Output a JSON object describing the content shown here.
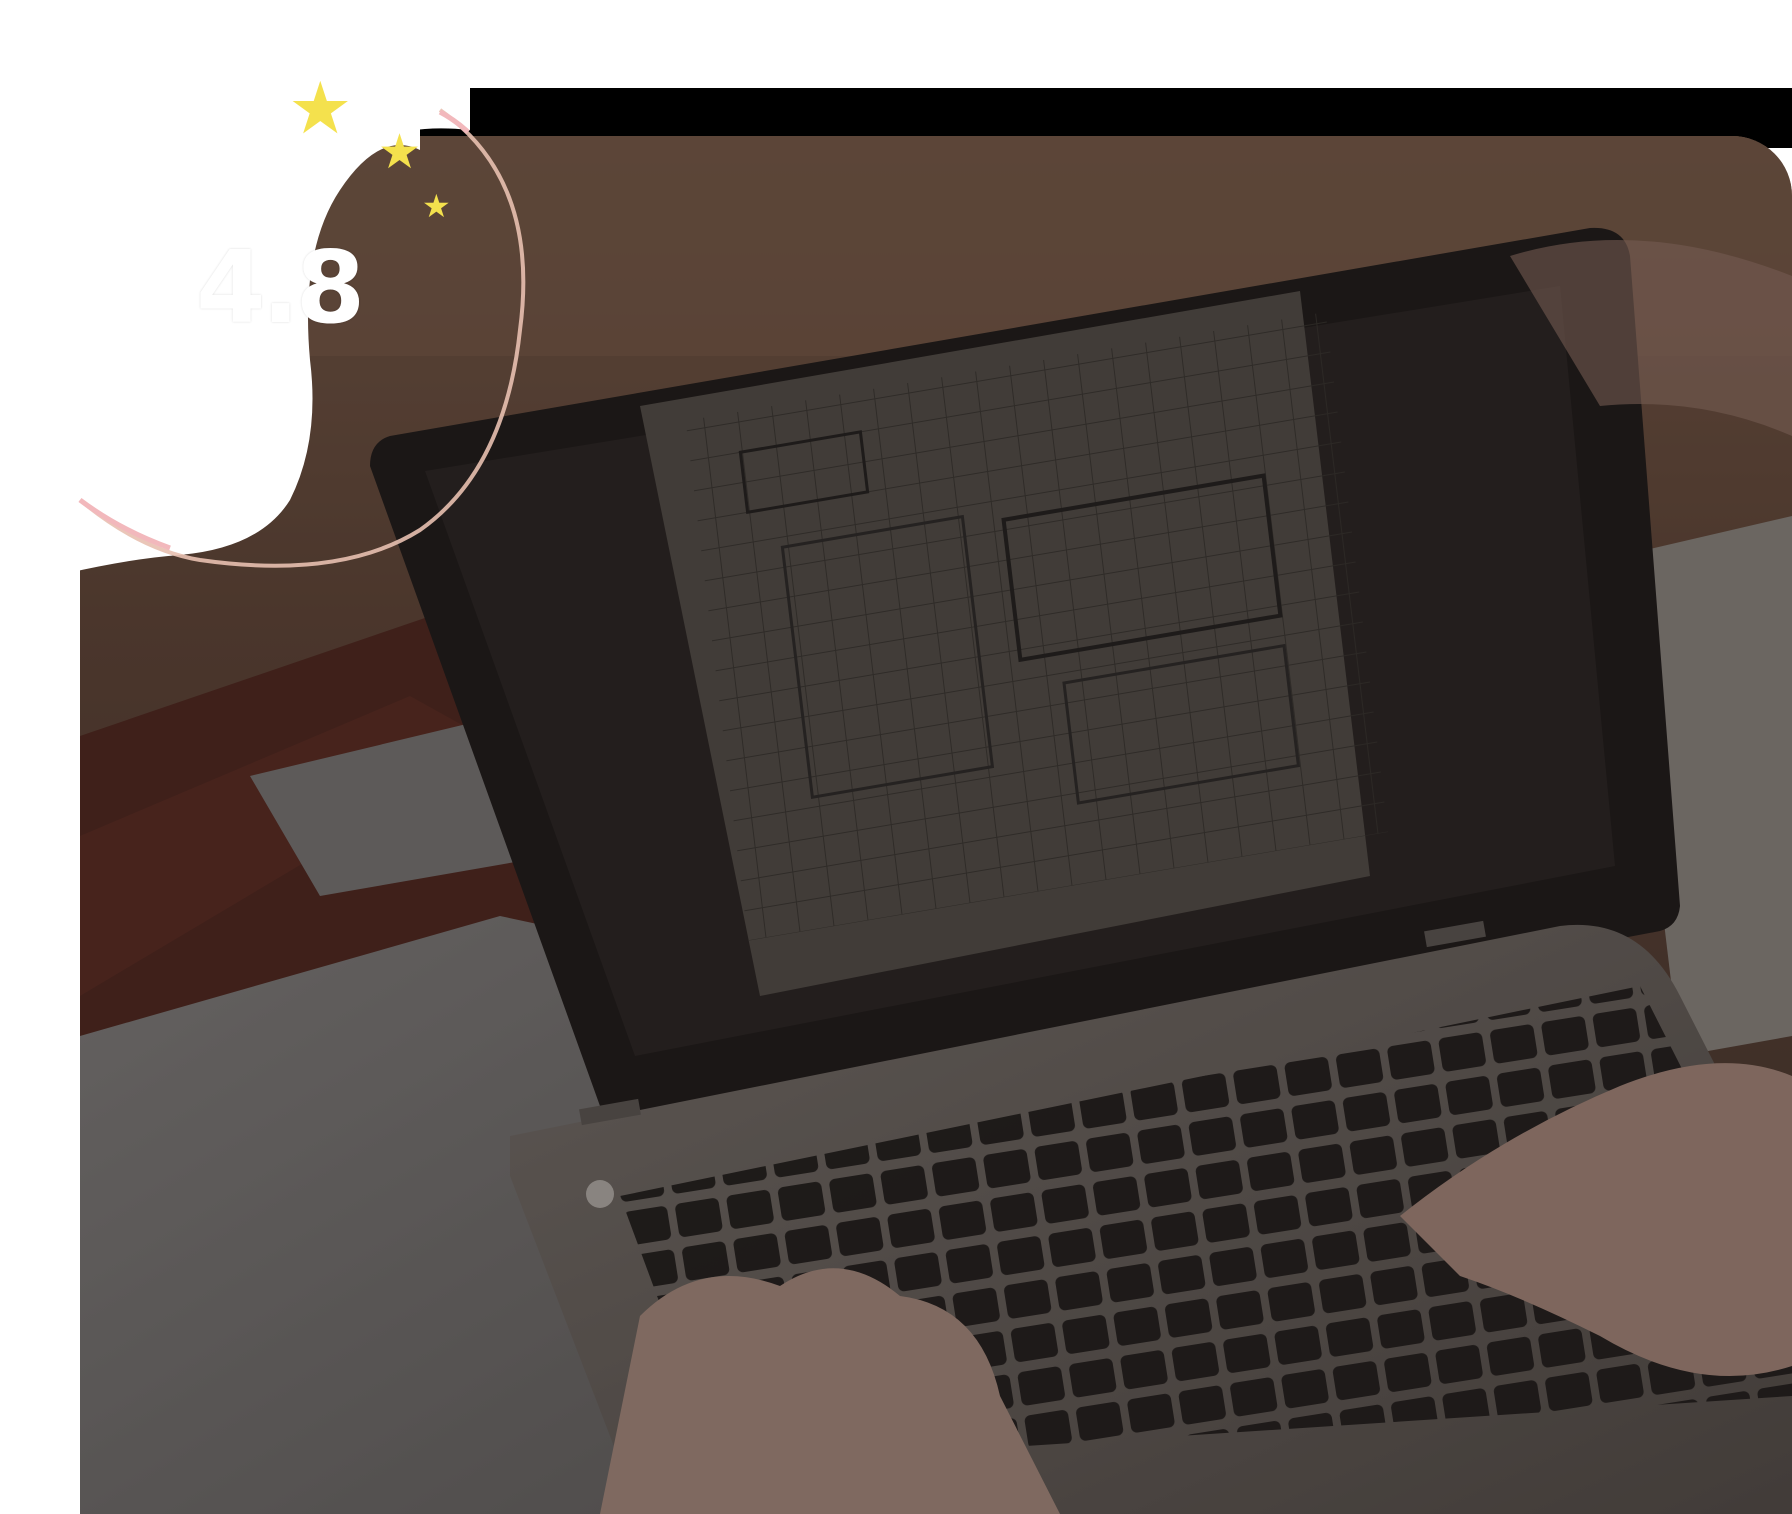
{
  "rating": {
    "value": "4.8",
    "stars": 3
  },
  "photo": {
    "subject": "laptop-with-floor-plan",
    "overlay_color": "#1a1410"
  },
  "colors": {
    "star": "#f4e14d",
    "arc": "#e8c0b0",
    "accent_pink": "#f2b8bc"
  }
}
